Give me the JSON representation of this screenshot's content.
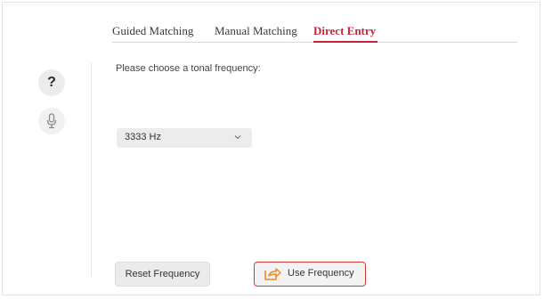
{
  "tabs": [
    {
      "label": "Guided Matching",
      "active": false
    },
    {
      "label": "Manual Matching",
      "active": false
    },
    {
      "label": "Direct Entry",
      "active": true
    }
  ],
  "sidebar": {
    "help_label": "?",
    "help_icon": "question-icon",
    "mic_icon": "microphone-icon"
  },
  "main": {
    "prompt": "Please choose a tonal frequency:",
    "frequency_select": {
      "value": "3333 Hz",
      "icon": "chevron-down-icon"
    },
    "reset_button": "Reset Frequency",
    "use_button": {
      "label": "Use Frequency",
      "icon": "share-arrow-icon"
    }
  },
  "colors": {
    "accent": "#c8243d",
    "use_button_border": "#d0382e",
    "use_icon": "#f08a24"
  }
}
